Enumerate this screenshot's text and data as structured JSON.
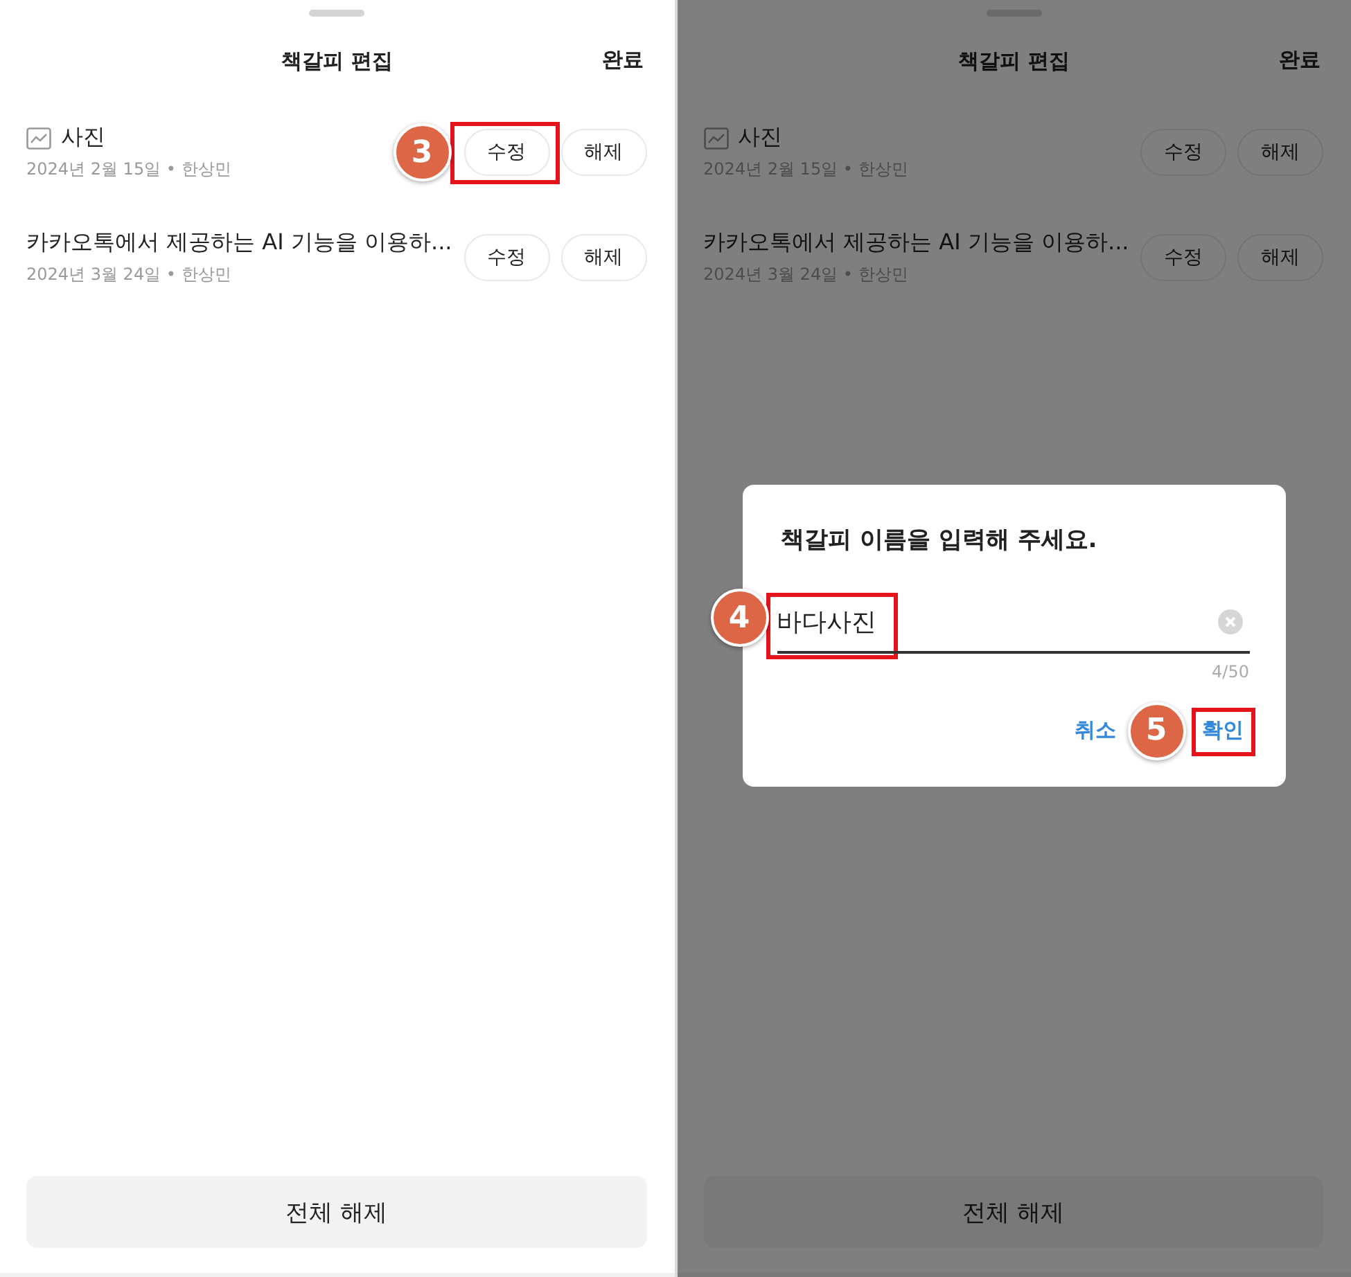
{
  "panels": [
    {
      "dimmed": false,
      "title": "책갈피 편집",
      "done_button": "완료",
      "bookmarks": [
        {
          "kind": "picture",
          "title": "사진",
          "meta": "2024년 2월 15일 • 한상민",
          "edit_button": {
            "label": "수정",
            "highlighted": true,
            "step": "3"
          },
          "remove_button": "해제"
        },
        {
          "kind": "text",
          "title": "카카오톡에서 제공하는 AI 기능을 이용하...",
          "meta": "2024년 3월 24일 • 한상민",
          "edit_button": {
            "label": "수정",
            "highlighted": false
          },
          "remove_button": "해제"
        }
      ],
      "clear_all_button": "전체 해제"
    },
    {
      "dimmed": true,
      "title": "책갈피 편집",
      "done_button": "완료",
      "bookmarks": [
        {
          "kind": "picture",
          "title": "사진",
          "meta": "2024년 2월 15일 • 한상민",
          "edit_button": {
            "label": "수정",
            "highlighted": false
          },
          "remove_button": "해제"
        },
        {
          "kind": "text",
          "title": "카카오톡에서 제공하는 AI 기능을 이용하...",
          "meta": "2024년 3월 24일 • 한상민",
          "edit_button": {
            "label": "수정",
            "highlighted": false
          },
          "remove_button": "해제"
        }
      ],
      "clear_all_button": "전체 해제",
      "dialog": {
        "title": "책갈피 이름을 입력해 주세요.",
        "value": "바다사진",
        "value_highlighted": true,
        "value_step": "4",
        "counter": "4/50",
        "cancel_button": "취소",
        "confirm_button": {
          "label": "확인",
          "highlighted": true,
          "step": "5"
        }
      }
    }
  ]
}
